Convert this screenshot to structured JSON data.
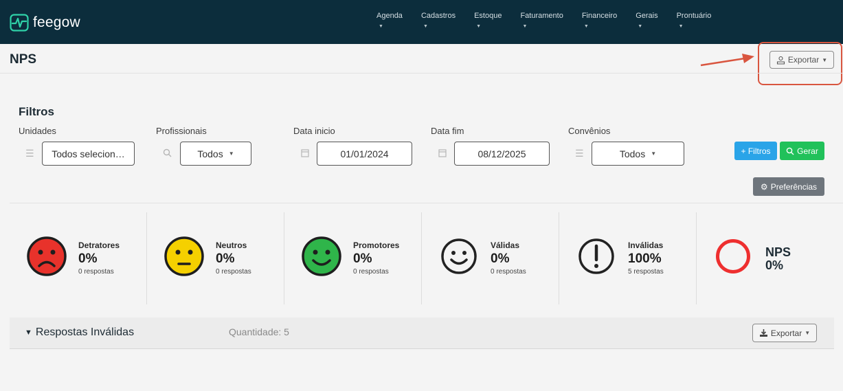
{
  "app": {
    "logo_text": "feegow"
  },
  "nav": {
    "items": [
      {
        "label": "Agenda"
      },
      {
        "label": "Cadastros"
      },
      {
        "label": "Estoque"
      },
      {
        "label": "Faturamento"
      },
      {
        "label": "Financeiro"
      },
      {
        "label": "Gerais"
      },
      {
        "label": "Prontuário"
      }
    ]
  },
  "header": {
    "title": "NPS",
    "export_label": "Exportar"
  },
  "filters": {
    "title": "Filtros",
    "unidades": {
      "label": "Unidades",
      "value": "Todos selecion…"
    },
    "profissionais": {
      "label": "Profissionais",
      "value": "Todos"
    },
    "data_inicio": {
      "label": "Data inicio",
      "value": "01/01/2024"
    },
    "data_fim": {
      "label": "Data fim",
      "value": "08/12/2025"
    },
    "convenios": {
      "label": "Convênios",
      "value": "Todos"
    },
    "btn_filtros": "+ Filtros",
    "btn_gerar": "Gerar",
    "btn_preferencias": "Preferências"
  },
  "stats": [
    {
      "label": "Detratores",
      "pct": "0%",
      "resp": "0 respostas",
      "icon": "sad-face-icon",
      "color": "#e8322b"
    },
    {
      "label": "Neutros",
      "pct": "0%",
      "resp": "0 respostas",
      "icon": "neutral-face-icon",
      "color": "#f5d000"
    },
    {
      "label": "Promotores",
      "pct": "0%",
      "resp": "0 respostas",
      "icon": "happy-face-icon",
      "color": "#2fb54a"
    },
    {
      "label": "Válidas",
      "pct": "0%",
      "resp": "0 respostas",
      "icon": "smile-outline-icon",
      "color": "#222222"
    },
    {
      "label": "Inválidas",
      "pct": "100%",
      "resp": "5 respostas",
      "icon": "exclamation-icon",
      "color": "#222222"
    }
  ],
  "nps": {
    "label": "NPS",
    "value": "0%",
    "ring_color": "#ee2f2f"
  },
  "invalid_section": {
    "title": "Respostas Inválidas",
    "quantity": "Quantidade: 5",
    "export_label": "Exportar"
  }
}
